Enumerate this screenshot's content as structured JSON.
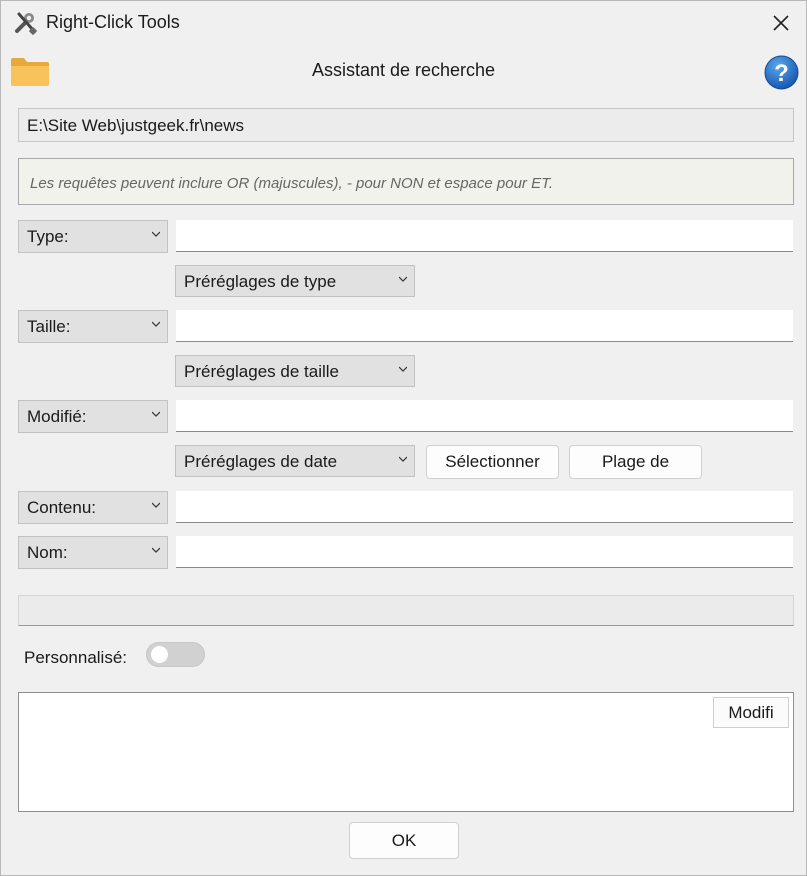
{
  "window": {
    "title": "Right-Click Tools"
  },
  "header": {
    "title": "Assistant de recherche"
  },
  "path": {
    "value": "E:\\Site Web\\justgeek.fr\\news"
  },
  "hint": {
    "text": "Les requêtes peuvent inclure OR (majuscules), - pour NON et espace pour ET."
  },
  "fields": {
    "type": {
      "label": "Type:",
      "value": ""
    },
    "type_presets": {
      "label": "Préréglages de type"
    },
    "size": {
      "label": "Taille:",
      "value": ""
    },
    "size_presets": {
      "label": "Préréglages de taille"
    },
    "modified": {
      "label": "Modifié:",
      "value": ""
    },
    "date_presets": {
      "label": "Préréglages de date"
    },
    "select_button": "Sélectionner",
    "range_button": "Plage de",
    "content": {
      "label": "Contenu:",
      "value": ""
    },
    "name": {
      "label": "Nom:",
      "value": ""
    }
  },
  "custom": {
    "label": "Personnalisé:",
    "enabled": false
  },
  "query": {
    "modify_button": "Modifi",
    "value": ""
  },
  "footer": {
    "ok_button": "OK"
  },
  "icons": {
    "app": "tools-icon",
    "close": "close-icon",
    "folder": "folder-icon",
    "help": "help-icon",
    "chevron": "chevron-down-icon"
  },
  "colors": {
    "help_blue": "#1f6fc5",
    "folder_yellow": "#f5b94a"
  }
}
